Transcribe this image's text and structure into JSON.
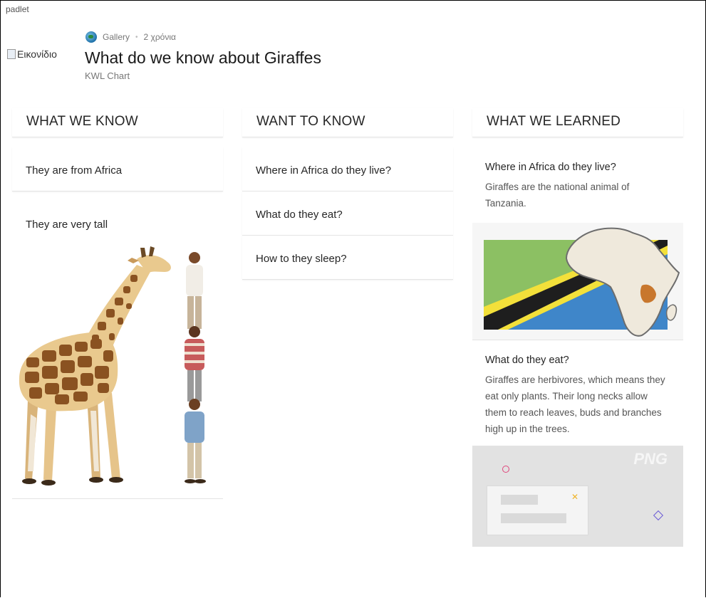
{
  "app": {
    "name": "padlet"
  },
  "header": {
    "thumbnail_alt": "Εικονίδιο",
    "section": "Gallery",
    "age": "2 χρόνια",
    "title": "What do we know about Giraffes",
    "subtitle": "KWL Chart"
  },
  "columns": [
    {
      "title": "WHAT WE KNOW",
      "posts": [
        {
          "title": "They are from Africa"
        },
        {
          "title": "They are very tall"
        }
      ]
    },
    {
      "title": "WANT TO KNOW",
      "posts": [
        {
          "title": "Where in Africa do they live?"
        },
        {
          "title": "What do they eat?"
        },
        {
          "title": "How to they sleep?"
        }
      ]
    },
    {
      "title": "WHAT WE LEARNED",
      "posts": [
        {
          "title": "Where in Africa do they live?",
          "body": "Giraffes are the national animal of Tanzania."
        },
        {
          "title": "What do they eat?",
          "body": "Giraffes are herbivores, which means they eat only plants. Their long necks allow them to reach leaves, buds and branches high up in the trees."
        }
      ]
    }
  ],
  "attachments": {
    "placeholder_label": "PNG"
  },
  "colors": {
    "tanzania_green": "#8cc063",
    "tanzania_blue": "#3f86c9",
    "tanzania_yellow": "#f3e03a",
    "tanzania_black": "#1e1e1e",
    "africa_fill": "#efe9dc",
    "tanzania_highlight": "#c8772d",
    "giraffe_base": "#e9c98e",
    "giraffe_spots": "#8a5221"
  },
  "icons": {
    "gallery": "globe-icon",
    "broken_image": "broken-image-icon"
  }
}
